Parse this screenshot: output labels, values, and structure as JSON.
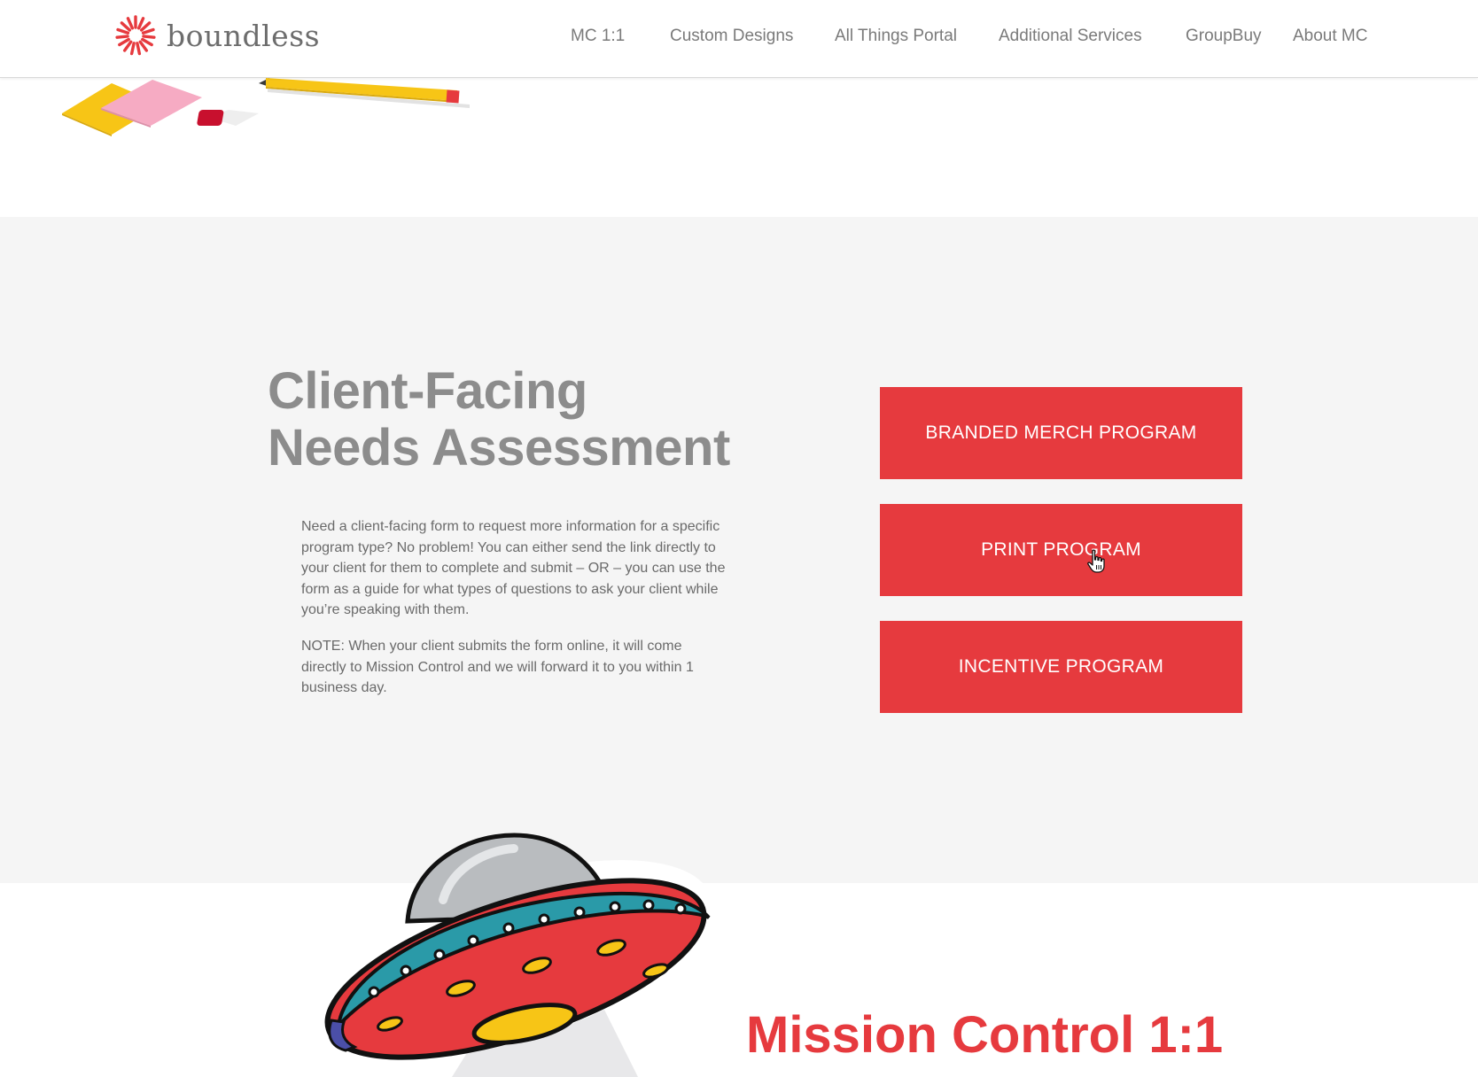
{
  "header": {
    "logo_text": "boundless",
    "nav": [
      {
        "label": "MC 1:1"
      },
      {
        "label": "Custom Designs"
      },
      {
        "label": "All Things Portal"
      },
      {
        "label": "Additional Services"
      },
      {
        "label": "GroupBuy"
      },
      {
        "label": "About MC"
      }
    ]
  },
  "assessment": {
    "title_line1": "Client-Facing",
    "title_line2": "Needs Assessment",
    "paragraph1": "Need a client-facing form to request more information for a specific program type? No problem! You can either send the link directly to your client for them to complete and submit – OR – you can use the form as a guide for what types of questions to ask your client while you’re speaking with them.",
    "paragraph2": "NOTE: When your client submits the form online, it will come directly to Mission Control and we will forward it to you within 1 business day.",
    "buttons": [
      {
        "label": "BRANDED MERCH PROGRAM"
      },
      {
        "label": "PRINT PROGRAM"
      },
      {
        "label": "INCENTIVE PROGRAM"
      }
    ]
  },
  "mission_control": {
    "title": "Mission Control 1:1"
  },
  "colors": {
    "accent": "#e63a3e",
    "section_bg": "#f5f5f5",
    "title_grey": "#8c8c8c",
    "nav_text": "#7a7a7a"
  },
  "icons": {
    "logo": "boundless-starburst-logo",
    "cursor": "hand-pointer-cursor",
    "desk_art": "sticky-notes-eraser-pencil-illustration",
    "ufo": "flying-saucer-illustration"
  }
}
